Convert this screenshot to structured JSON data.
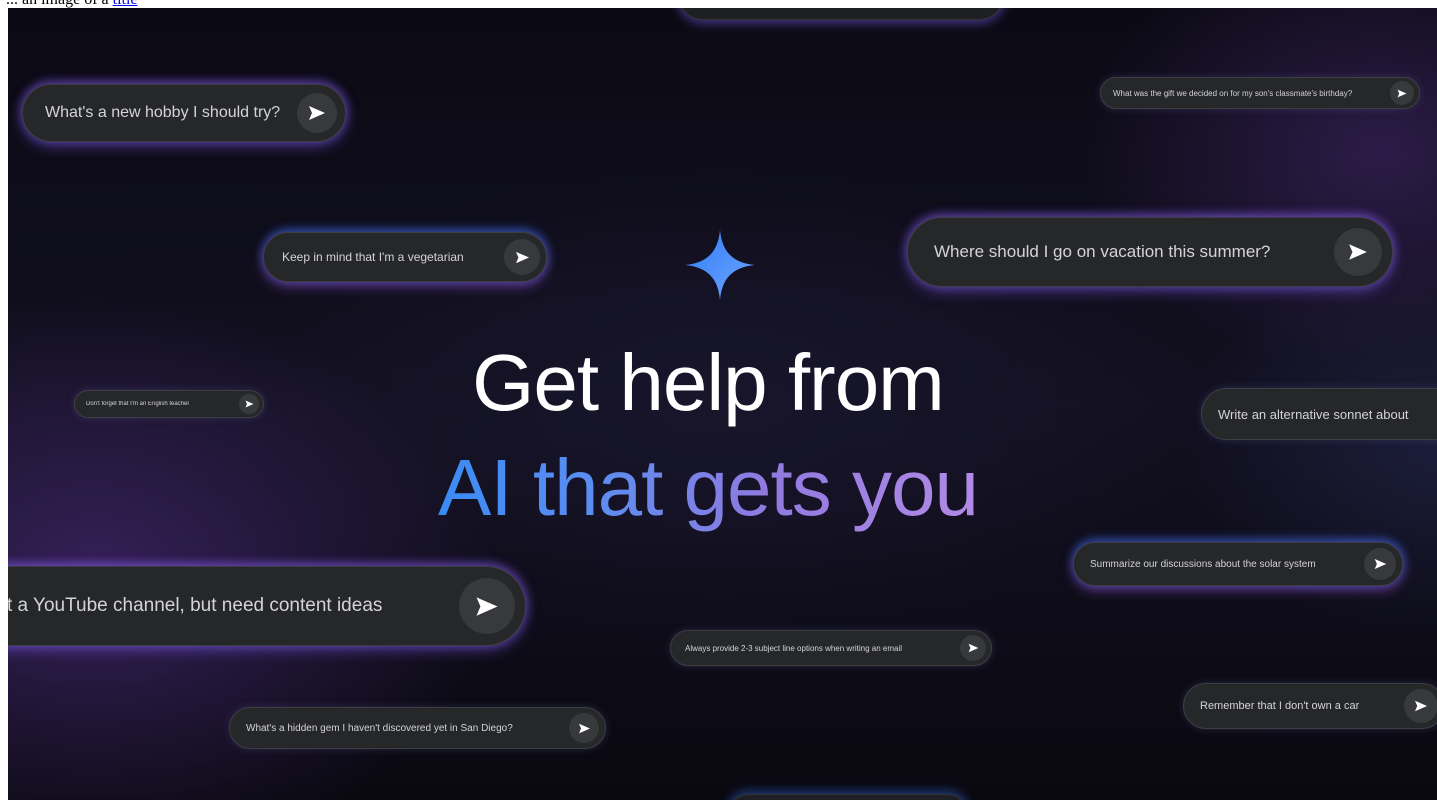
{
  "header": {
    "prefix": "... an image of a",
    "link": "title"
  },
  "headline": {
    "line1": "Get help from",
    "line2": "AI that gets you"
  },
  "prompts": {
    "hobby": "What's a new hobby I should try?",
    "gift": "What was the gift we decided on for my son's classmate's birthday?",
    "vegetarian": "Keep in mind that I'm a vegetarian",
    "vacation": "Where should I go on vacation this summer?",
    "teacher": "Don't forget that I'm an English teacher",
    "sonnet": "Write an alternative sonnet about",
    "youtube": "t a YouTube channel, but need content ideas",
    "solar": "Summarize our discussions about the solar system",
    "email": "Always provide 2-3 subject line options when writing an email",
    "car": "Remember that I don't own a car",
    "gem": "What's a hidden gem I haven't discovered yet in San Diego?"
  },
  "icons": {
    "send": "send-arrow-icon",
    "sparkle": "sparkle-icon"
  },
  "colors": {
    "gradient_start": "#3a8bf5",
    "gradient_end": "#b18ae6",
    "pill_bg": "#262729"
  }
}
